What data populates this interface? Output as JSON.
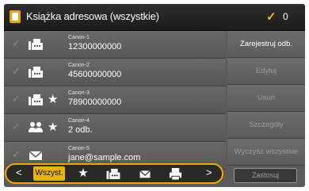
{
  "header": {
    "title": "Książka adresowa (wszystkie)",
    "selected_count": "0"
  },
  "entries": [
    {
      "check": "✓",
      "icon": "fax-icon",
      "favorite": false,
      "name": "Canon-1",
      "value": "12300000000"
    },
    {
      "check": "✓",
      "icon": "fax-icon",
      "favorite": false,
      "name": "Canon-2",
      "value": "45600000000"
    },
    {
      "check": "✓",
      "icon": "fax-icon",
      "favorite": true,
      "name": "Canon-3",
      "value": "78900000000"
    },
    {
      "check": "✓",
      "icon": "group-icon",
      "favorite": true,
      "name": "Canon-4",
      "value": "2 odb."
    },
    {
      "check": "✓",
      "icon": "email-icon",
      "favorite": false,
      "name": "Canon-5",
      "value": "jane@sample.com"
    }
  ],
  "actions": {
    "register": "Zarejestruj odb.",
    "edit": "Edytuj",
    "delete": "Usuń",
    "details": "Szczegóły",
    "clear_all": "Wyczyść wszystkie"
  },
  "filters": {
    "prev": "<",
    "all": "Wszyst.",
    "next": ">"
  },
  "apply_label": "Zastosuj",
  "colors": {
    "accent": "#f4a400",
    "checkmark": "#e6c000",
    "selected_filter": "#e6b600"
  }
}
